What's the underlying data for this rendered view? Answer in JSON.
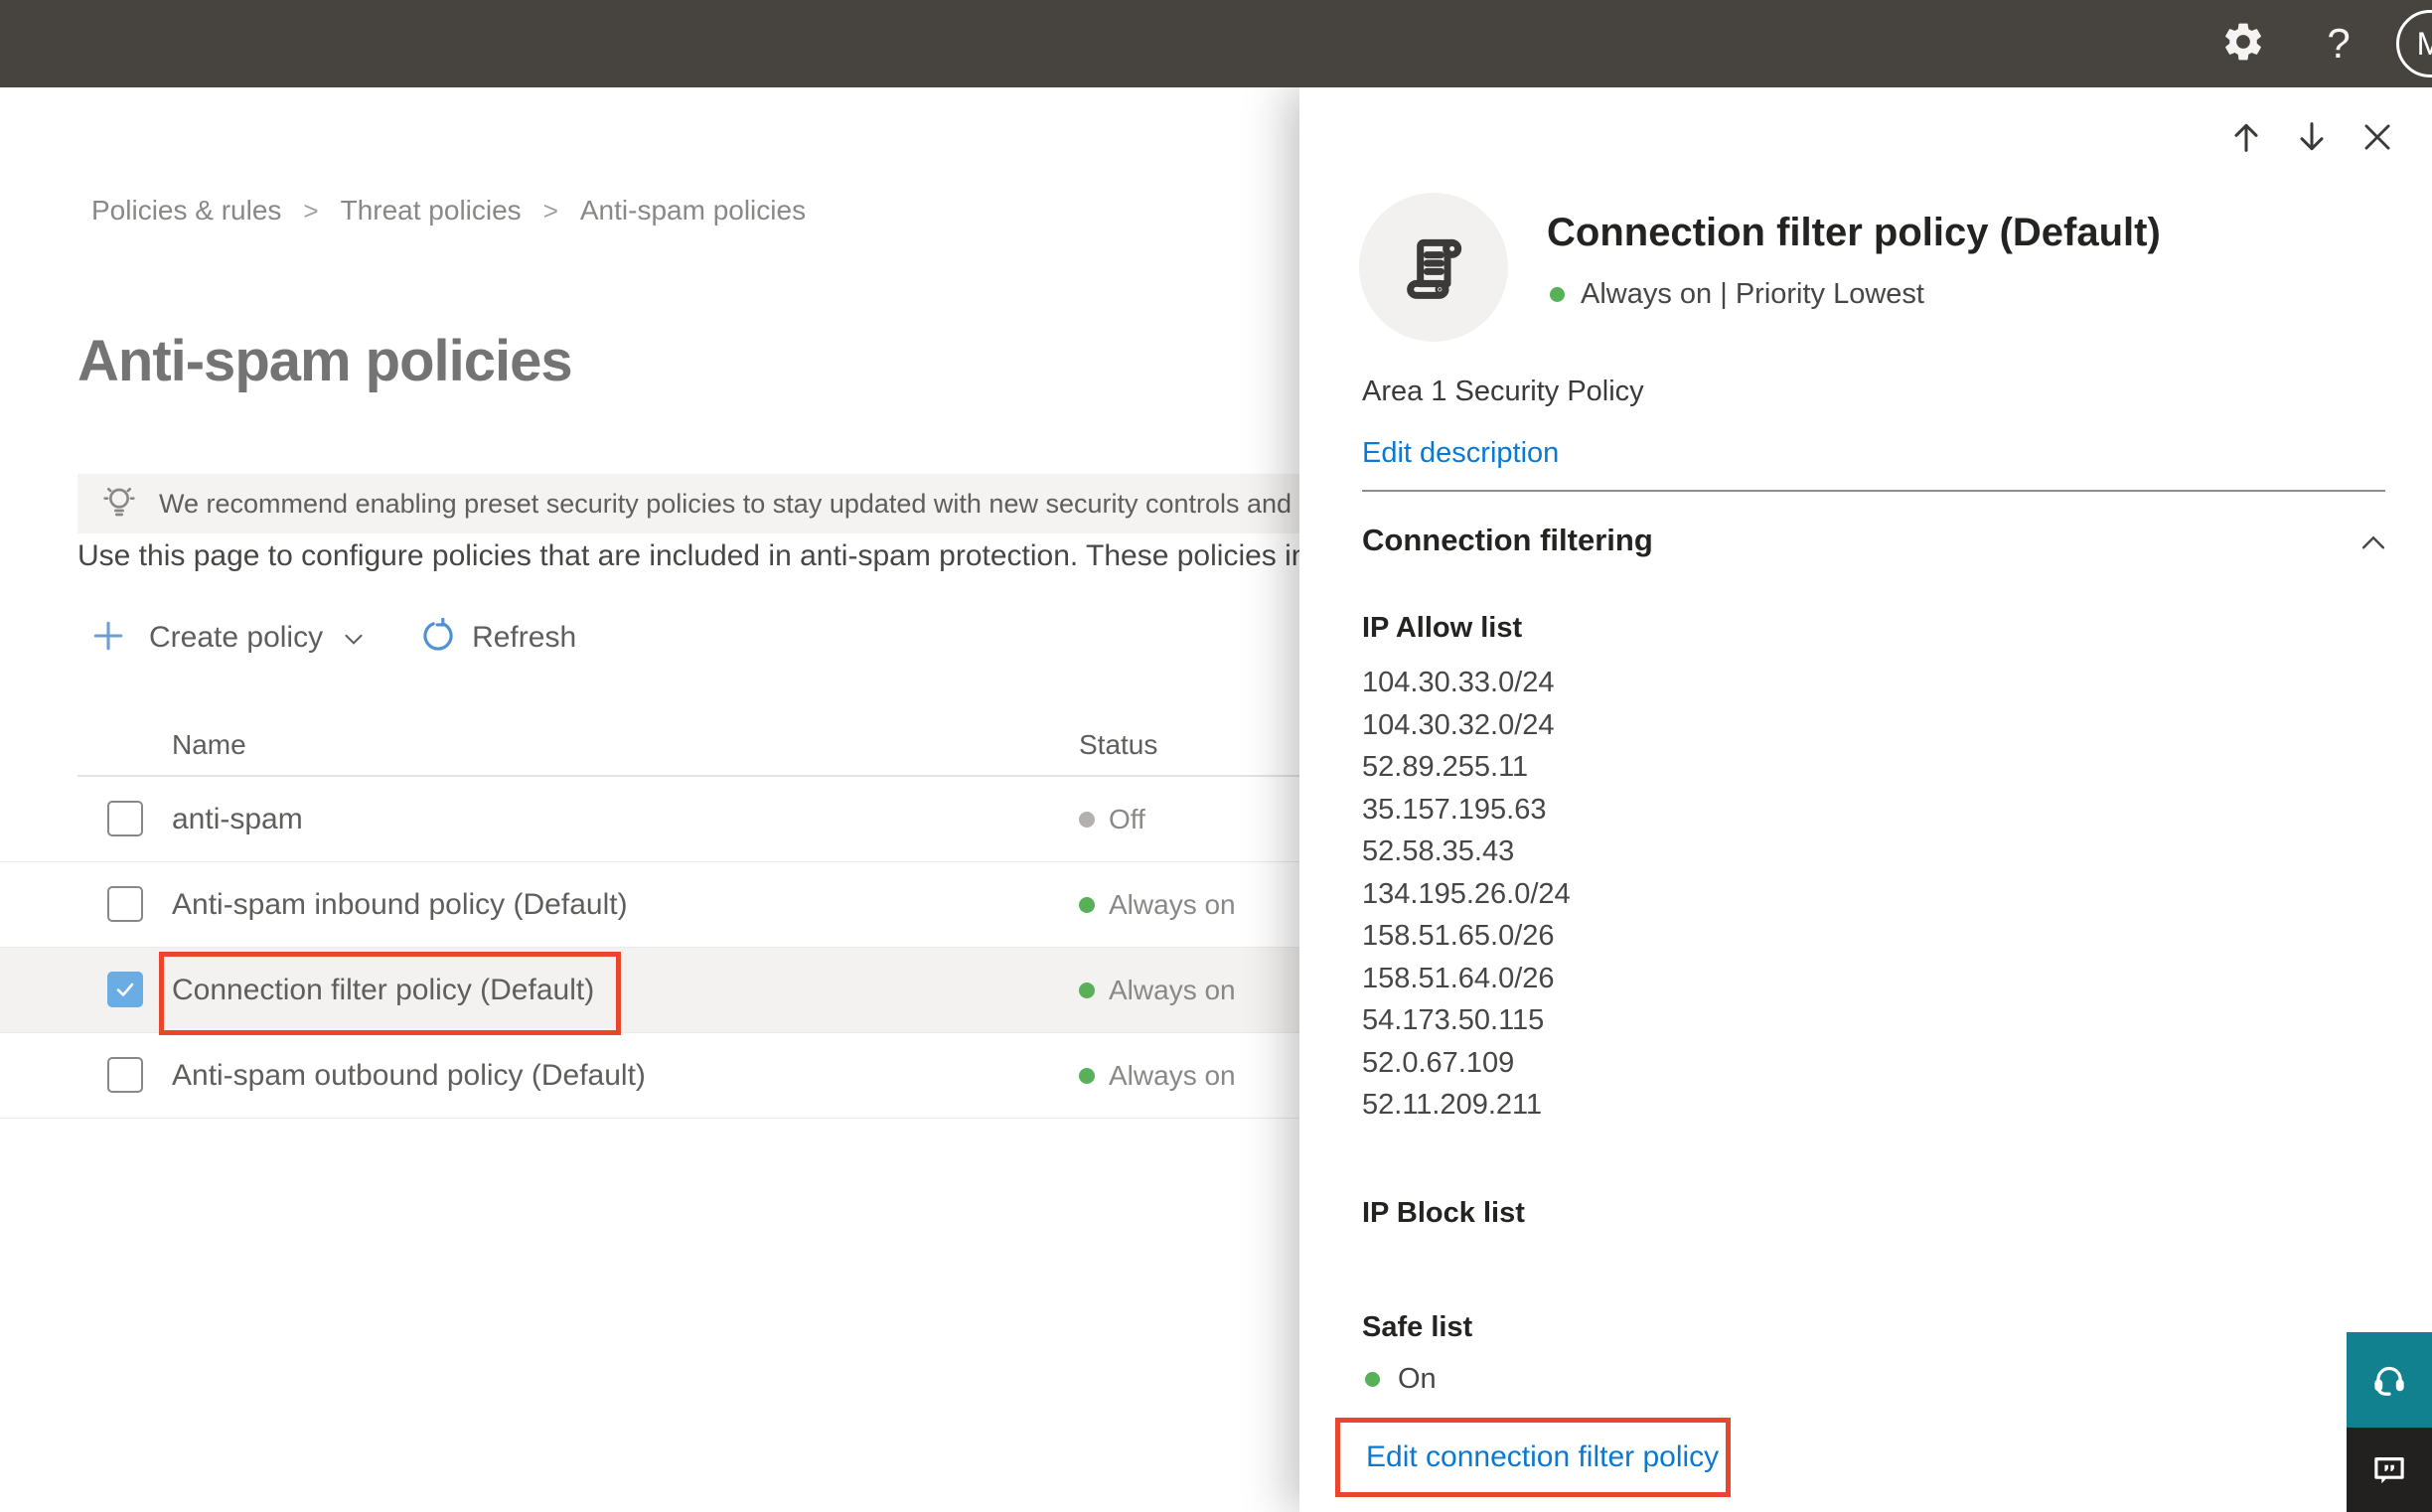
{
  "topbar": {
    "help_label": "?",
    "avatar_initial": "M"
  },
  "breadcrumb": {
    "separator": ">",
    "items": [
      "Policies & rules",
      "Threat policies",
      "Anti-spam policies"
    ]
  },
  "page": {
    "title": "Anti-spam policies",
    "banner_text": "We recommend enabling preset security policies to stay updated with new security controls and our recomme",
    "description": "Use this page to configure policies that are included in anti-spam protection. These policies include",
    "toolbar": {
      "create_label": "Create policy",
      "refresh_label": "Refresh"
    },
    "table": {
      "columns": [
        "Name",
        "Status"
      ],
      "rows": [
        {
          "name": "anti-spam",
          "status": "Off"
        },
        {
          "name": "Anti-spam inbound policy (Default)",
          "status": "Always on"
        },
        {
          "name": "Connection filter policy (Default)",
          "status": "Always on"
        },
        {
          "name": "Anti-spam outbound policy (Default)",
          "status": "Always on"
        }
      ]
    }
  },
  "flyout": {
    "title": "Connection filter policy (Default)",
    "status_line": "Always on | Priority Lowest",
    "description": "Area 1 Security Policy",
    "edit_description_label": "Edit description",
    "section_title": "Connection filtering",
    "ip_allow": {
      "label": "IP Allow list",
      "ips": [
        "104.30.33.0/24",
        "104.30.32.0/24",
        "52.89.255.11",
        "35.157.195.63",
        "52.58.35.43",
        "134.195.26.0/24",
        "158.51.65.0/26",
        "158.51.64.0/26",
        "54.173.50.115",
        "52.0.67.109",
        "52.11.209.211"
      ]
    },
    "ip_block": {
      "label": "IP Block list"
    },
    "safe_list": {
      "label": "Safe list",
      "value": "On"
    },
    "edit_link_label": "Edit connection filter policy"
  },
  "colors": {
    "topbar_bg": "#474440",
    "accent_blue": "#0b78d1",
    "annotation_red": "#e8472b",
    "status_green": "#58b158",
    "status_gray": "#b3b0ad",
    "checkbox_blue": "#69ade4",
    "teal_support": "#12818f",
    "feedback_dark": "#232120"
  }
}
